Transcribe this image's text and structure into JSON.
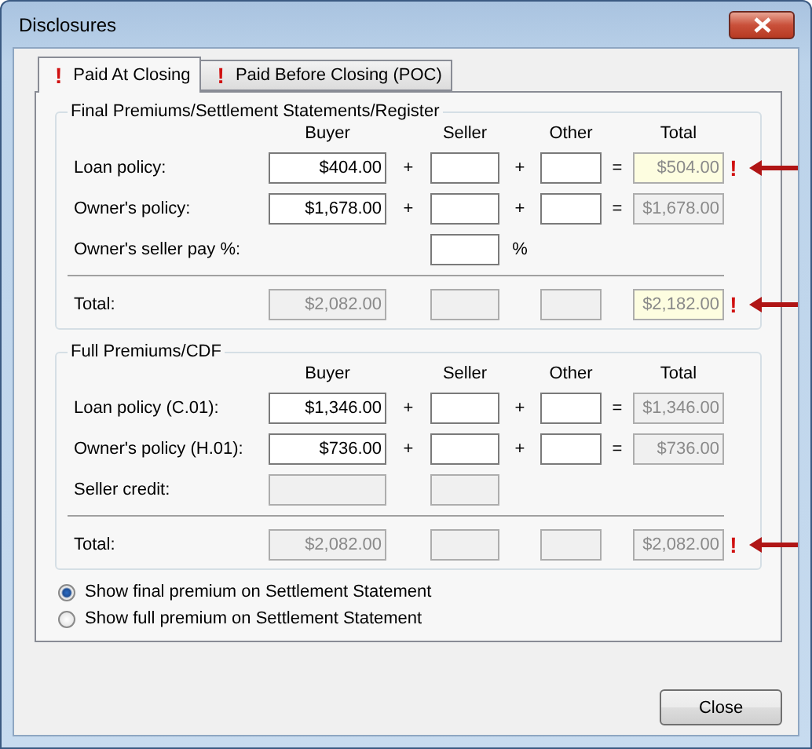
{
  "window": {
    "title": "Disclosures"
  },
  "tabs": [
    {
      "label": "Paid At Closing",
      "selected": true,
      "marker": "!"
    },
    {
      "label": "Paid Before Closing (POC)",
      "selected": false,
      "marker": "!"
    }
  ],
  "sections": [
    {
      "title": "Final Premiums/Settlement Statements/Register",
      "columns": [
        "Buyer",
        "Seller",
        "Other",
        "Total"
      ],
      "rows": [
        {
          "label": "Loan policy:",
          "cells": {
            "buyer": {
              "value": "$404.00",
              "readonly": false
            },
            "seller": {
              "readonly": false
            },
            "other": {
              "readonly": false
            },
            "total": {
              "value": "$504.00",
              "readonly": true,
              "highlight": true
            }
          },
          "operators": {
            "after_buyer": "+",
            "after_seller": "+",
            "after_other": "="
          },
          "warning": "!"
        },
        {
          "label": "Owner's policy:",
          "cells": {
            "buyer": {
              "value": "$1,678.00",
              "readonly": false
            },
            "seller": {
              "readonly": false
            },
            "other": {
              "readonly": false
            },
            "total": {
              "value": "$1,678.00",
              "readonly": true,
              "highlight": false
            }
          },
          "operators": {
            "after_buyer": "+",
            "after_seller": "+",
            "after_other": "="
          }
        },
        {
          "label": "Owner's seller pay %:",
          "cells": {
            "seller": {
              "readonly": false
            }
          },
          "operators": {
            "after_seller": "%"
          }
        }
      ],
      "total": {
        "label": "Total:",
        "cells": {
          "buyer": {
            "value": "$2,082.00",
            "readonly": true
          },
          "seller": {
            "readonly": true
          },
          "other": {
            "readonly": true
          },
          "total": {
            "value": "$2,182.00",
            "readonly": true,
            "highlight": true
          }
        },
        "warning": "!"
      }
    },
    {
      "title": "Full Premiums/CDF",
      "columns": [
        "Buyer",
        "Seller",
        "Other",
        "Total"
      ],
      "rows": [
        {
          "label": "Loan policy (C.01):",
          "cells": {
            "buyer": {
              "value": "$1,346.00",
              "readonly": false
            },
            "seller": {
              "readonly": false
            },
            "other": {
              "readonly": false
            },
            "total": {
              "value": "$1,346.00",
              "readonly": true,
              "highlight": false
            }
          },
          "operators": {
            "after_buyer": "+",
            "after_seller": "+",
            "after_other": "="
          }
        },
        {
          "label": "Owner's policy (H.01):",
          "cells": {
            "buyer": {
              "value": "$736.00",
              "readonly": false
            },
            "seller": {
              "readonly": false
            },
            "other": {
              "readonly": false
            },
            "total": {
              "value": "$736.00",
              "readonly": true,
              "highlight": false
            }
          },
          "operators": {
            "after_buyer": "+",
            "after_seller": "+",
            "after_other": "="
          }
        },
        {
          "label": "Seller credit:",
          "cells": {
            "buyer": {
              "readonly": true
            },
            "seller": {
              "readonly": true
            }
          }
        }
      ],
      "total": {
        "label": "Total:",
        "cells": {
          "buyer": {
            "value": "$2,082.00",
            "readonly": true
          },
          "seller": {
            "readonly": true
          },
          "other": {
            "readonly": true
          },
          "total": {
            "value": "$2,082.00",
            "readonly": true,
            "highlight": false
          }
        },
        "warning": "!"
      }
    }
  ],
  "options": [
    {
      "label": "Show final premium on Settlement Statement",
      "selected": true
    },
    {
      "label": "Show full premium on Settlement Statement",
      "selected": false
    }
  ],
  "buttons": [
    {
      "label": "Close"
    }
  ]
}
